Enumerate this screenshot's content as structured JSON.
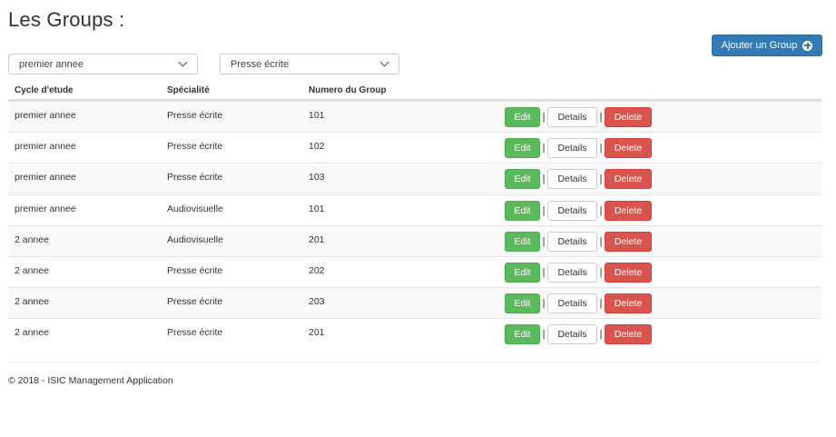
{
  "page": {
    "title": "Les Groups :",
    "add_button_label": "Ajouter un Group"
  },
  "filters": {
    "cycle_selected": "premier annee",
    "specialite_selected": "Presse écrite"
  },
  "table": {
    "headers": [
      "Cycle d'etude",
      "Spécialité",
      "Numero du Group"
    ],
    "rows": [
      {
        "cycle": "premier annee",
        "specialite": "Presse écrite",
        "numero": "101"
      },
      {
        "cycle": "premier annee",
        "specialite": "Presse écrite",
        "numero": "102"
      },
      {
        "cycle": "premier annee",
        "specialite": "Presse écrite",
        "numero": "103"
      },
      {
        "cycle": "premier annee",
        "specialite": "Audiovisuelle",
        "numero": "101"
      },
      {
        "cycle": "2 annee",
        "specialite": "Audiovisuelle",
        "numero": "201"
      },
      {
        "cycle": "2 annee",
        "specialite": "Presse écrite",
        "numero": "202"
      },
      {
        "cycle": "2 annee",
        "specialite": "Presse écrite",
        "numero": "203"
      },
      {
        "cycle": "2 annee",
        "specialite": "Presse écrite",
        "numero": "201"
      }
    ],
    "actions": {
      "edit": "Edit",
      "details": "Details",
      "delete": "Delete",
      "separator": "|"
    }
  },
  "footer": {
    "text": "© 2018 - ISIC Management Application"
  },
  "colors": {
    "primary": "#337ab7",
    "success": "#5cb85c",
    "danger": "#d9534f"
  },
  "icons": {
    "add": "plus-circle-icon",
    "dropdown": "chevron-down-icon"
  }
}
